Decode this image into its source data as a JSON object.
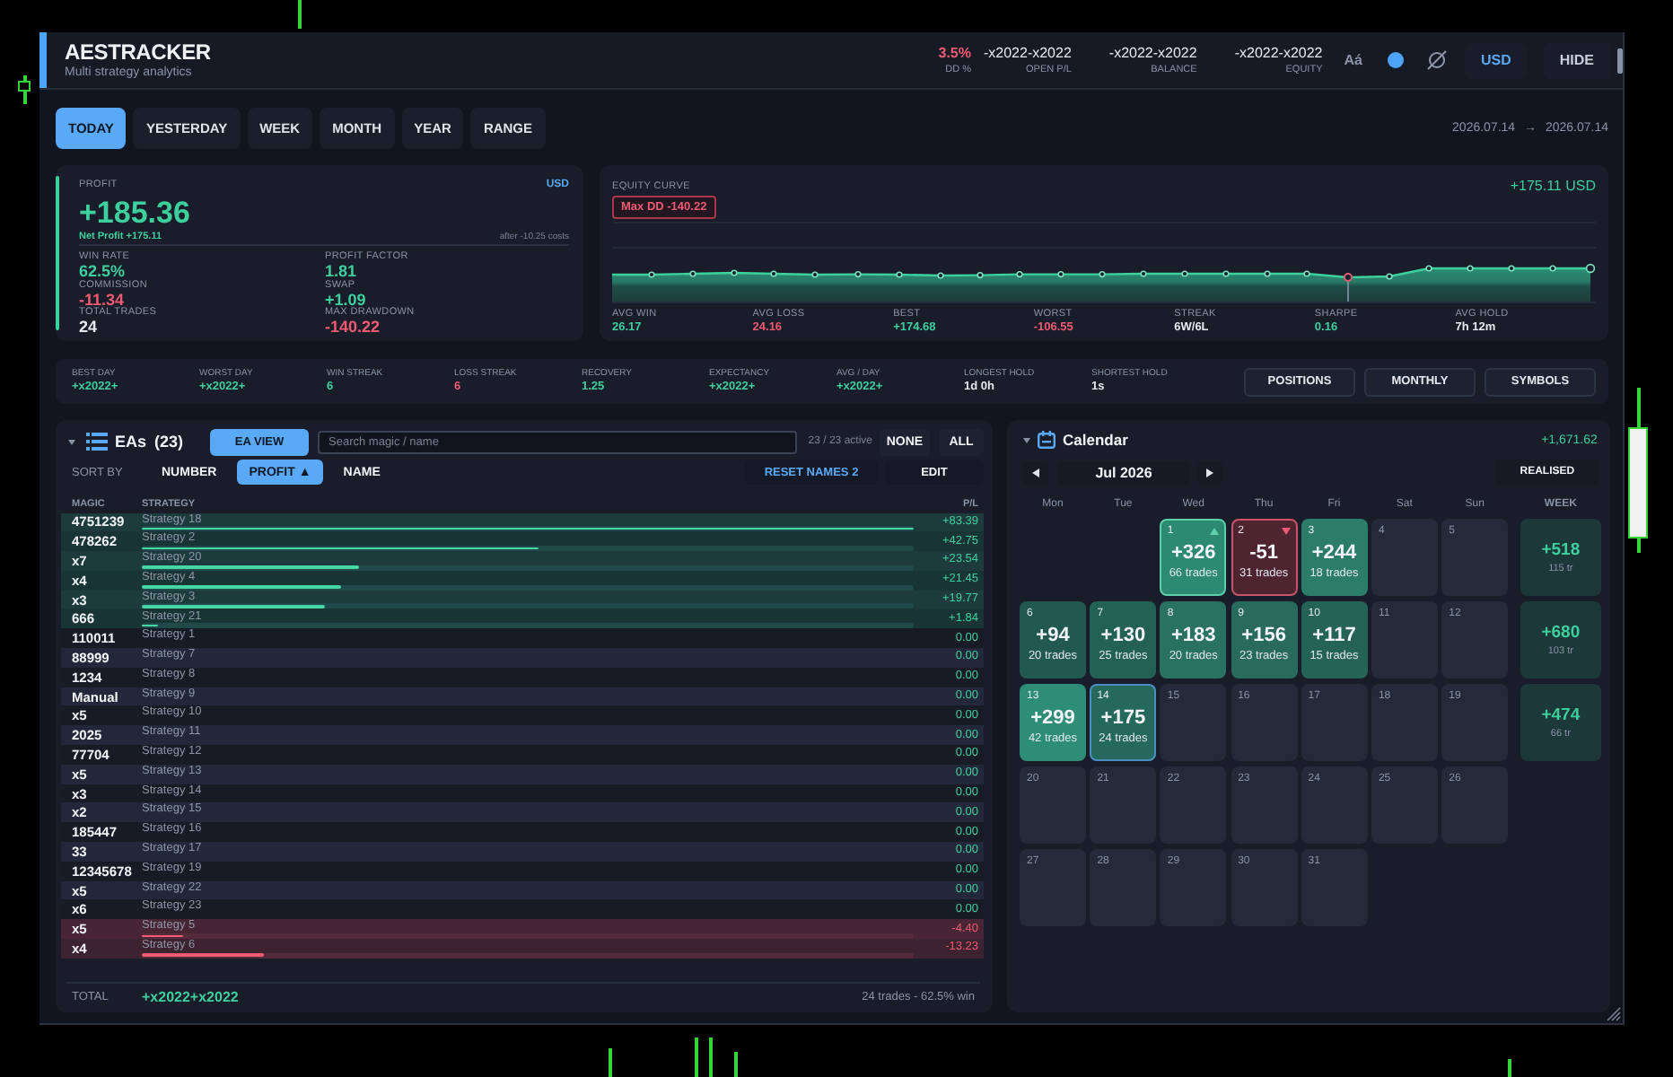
{
  "header": {
    "title": "AESTRACKER",
    "subtitle": "Multi strategy analytics",
    "stats": [
      {
        "value": "3.5%",
        "label": "DD %",
        "kind": "loss"
      },
      {
        "value": "-x2022-x2022",
        "label": "OPEN P/L",
        "kind": "neutral"
      },
      {
        "value": "-x2022-x2022",
        "label": "BALANCE",
        "kind": "neutral"
      },
      {
        "value": "-x2022-x2022",
        "label": "EQUITY",
        "kind": "neutral"
      }
    ],
    "font_button": "Aá",
    "currency_button": "USD",
    "hide_button": "HIDE"
  },
  "tabs": [
    {
      "label": "TODAY",
      "selected": true
    },
    {
      "label": "YESTERDAY",
      "selected": false
    },
    {
      "label": "WEEK",
      "selected": false
    },
    {
      "label": "MONTH",
      "selected": false
    },
    {
      "label": "YEAR",
      "selected": false
    },
    {
      "label": "RANGE",
      "selected": false
    }
  ],
  "date_range": "2026.07.14 → 2026.07.14",
  "profit": {
    "label": "PROFIT",
    "currency": "USD",
    "value": "+185.36",
    "net": "Net Profit +175.11",
    "costs": "after -10.25 costs",
    "stats": [
      {
        "label": "WIN RATE",
        "value": "62.5%",
        "kind": "gain"
      },
      {
        "label": "PROFIT FACTOR",
        "value": "1.81",
        "kind": "gain"
      },
      {
        "label": "COMMISSION",
        "value": "-11.34",
        "kind": "loss"
      },
      {
        "label": "SWAP",
        "value": "+1.09",
        "kind": "gain"
      },
      {
        "label": "TOTAL TRADES",
        "value": "24",
        "kind": "neutral"
      },
      {
        "label": "MAX DRAWDOWN",
        "value": "-140.22",
        "kind": "loss"
      }
    ]
  },
  "equity": {
    "label": "EQUITY CURVE",
    "total": "+175.11 USD",
    "max_dd": "Max DD -140.22",
    "stats": [
      {
        "label": "AVG WIN",
        "value": "26.17",
        "kind": "gain"
      },
      {
        "label": "AVG LOSS",
        "value": "24.16",
        "kind": "loss"
      },
      {
        "label": "BEST",
        "value": "+174.68",
        "kind": "gain"
      },
      {
        "label": "WORST",
        "value": "-106.55",
        "kind": "loss"
      },
      {
        "label": "STREAK",
        "value": "6W/6L",
        "kind": "neutral"
      },
      {
        "label": "SHARPE",
        "value": "0.16",
        "kind": "gain"
      },
      {
        "label": "AVG HOLD",
        "value": "7h 12m",
        "kind": "neutral"
      }
    ]
  },
  "summary": {
    "stats": [
      {
        "label": "BEST DAY",
        "value": "+x2022+",
        "kind": "gain"
      },
      {
        "label": "WORST DAY",
        "value": "+x2022+",
        "kind": "gain"
      },
      {
        "label": "WIN STREAK",
        "value": "6",
        "kind": "gain"
      },
      {
        "label": "LOSS STREAK",
        "value": "6",
        "kind": "loss"
      },
      {
        "label": "RECOVERY",
        "value": "1.25",
        "kind": "gain"
      },
      {
        "label": "EXPECTANCY",
        "value": "+x2022+",
        "kind": "gain"
      },
      {
        "label": "AVG / DAY",
        "value": "+x2022+",
        "kind": "gain"
      },
      {
        "label": "LONGEST HOLD",
        "value": "1d 0h",
        "kind": "neutral"
      },
      {
        "label": "SHORTEST HOLD",
        "value": "1s",
        "kind": "neutral"
      }
    ],
    "buttons": [
      "POSITIONS",
      "MONTHLY",
      "SYMBOLS"
    ]
  },
  "eas": {
    "title": "EAs (23)",
    "view_button": "EA VIEW",
    "search": {
      "placeholder": "Search magic / name"
    },
    "active": "23 / 23 active",
    "none_button": "NONE",
    "all_button": "ALL",
    "sort_label": "SORT BY",
    "sort_options": [
      {
        "label": "NUMBER",
        "selected": false
      },
      {
        "label": "PROFIT ▲",
        "selected": true
      },
      {
        "label": "NAME",
        "selected": false
      }
    ],
    "reset_button": "RESET NAMES 2",
    "edit_button": "EDIT",
    "columns": [
      "MAGIC",
      "STRATEGY",
      "P/L"
    ],
    "rows": [
      {
        "magic": "4751239",
        "strategy": "Strategy 18",
        "pl": "+83.39",
        "kind": "gain",
        "level": 1
      },
      {
        "magic": "478262",
        "strategy": "Strategy 2",
        "pl": "+42.75",
        "kind": "gain",
        "level": 0.513
      },
      {
        "magic": "x7",
        "strategy": "Strategy 20",
        "pl": "+23.54",
        "kind": "gain",
        "level": 0.282
      },
      {
        "magic": "x4",
        "strategy": "Strategy 4",
        "pl": "+21.45",
        "kind": "gain",
        "level": 0.257
      },
      {
        "magic": "x3",
        "strategy": "Strategy 3",
        "pl": "+19.77",
        "kind": "gain",
        "level": 0.237
      },
      {
        "magic": "666",
        "strategy": "Strategy 21",
        "pl": "+1.84",
        "kind": "gain",
        "level": 0.022
      },
      {
        "magic": "110011",
        "strategy": "Strategy 1",
        "pl": "0.00",
        "kind": "flat"
      },
      {
        "magic": "88999",
        "strategy": "Strategy 7",
        "pl": "0.00",
        "kind": "flat"
      },
      {
        "magic": "1234",
        "strategy": "Strategy 8",
        "pl": "0.00",
        "kind": "flat"
      },
      {
        "magic": "Manual",
        "strategy": "Strategy 9",
        "pl": "0.00",
        "kind": "flat"
      },
      {
        "magic": "x5",
        "strategy": "Strategy 10",
        "pl": "0.00",
        "kind": "flat"
      },
      {
        "magic": "2025",
        "strategy": "Strategy 11",
        "pl": "0.00",
        "kind": "flat"
      },
      {
        "magic": "77704",
        "strategy": "Strategy 12",
        "pl": "0.00",
        "kind": "flat"
      },
      {
        "magic": "x5",
        "strategy": "Strategy 13",
        "pl": "0.00",
        "kind": "flat"
      },
      {
        "magic": "x3",
        "strategy": "Strategy 14",
        "pl": "0.00",
        "kind": "flat"
      },
      {
        "magic": "x2",
        "strategy": "Strategy 15",
        "pl": "0.00",
        "kind": "flat"
      },
      {
        "magic": "185447",
        "strategy": "Strategy 16",
        "pl": "0.00",
        "kind": "flat"
      },
      {
        "magic": "33",
        "strategy": "Strategy 17",
        "pl": "0.00",
        "kind": "flat"
      },
      {
        "magic": "12345678",
        "strategy": "Strategy 19",
        "pl": "0.00",
        "kind": "flat"
      },
      {
        "magic": "x5",
        "strategy": "Strategy 22",
        "pl": "0.00",
        "kind": "flat"
      },
      {
        "magic": "x6",
        "strategy": "Strategy 23",
        "pl": "0.00",
        "kind": "flat"
      },
      {
        "magic": "x5",
        "strategy": "Strategy 5",
        "pl": "-4.40",
        "kind": "loss",
        "level": 0.053
      },
      {
        "magic": "x4",
        "strategy": "Strategy 6",
        "pl": "-13.23",
        "kind": "loss",
        "level": 0.159
      }
    ],
    "total": {
      "label": "TOTAL",
      "value": "+x2022+x2022",
      "summary": "24 trades - 62.5% win"
    }
  },
  "calendar": {
    "title": "Calendar",
    "total": "+1,671.62",
    "month": "Jul 2026",
    "mode_button": "REALISED",
    "weekdays": [
      "Mon",
      "Tue",
      "Wed",
      "Thu",
      "Fri",
      "Sat",
      "Sun",
      "WEEK"
    ],
    "weeks": [
      {
        "days": [
          {
            "kind": "blank"
          },
          {
            "kind": "blank"
          },
          {
            "kind": "best",
            "date": "1",
            "pl": "+326",
            "trades": "66 trades",
            "color": "#2c8a73",
            "today": false
          },
          {
            "kind": "worst",
            "date": "2",
            "pl": "-51",
            "trades": "31 trades",
            "color": "#4f2431",
            "today": false
          },
          {
            "kind": "day",
            "date": "3",
            "pl": "+244",
            "trades": "18 trades",
            "color": "#2b7d6a",
            "today": false
          },
          {
            "kind": "day",
            "date": "4",
            "today": false
          },
          {
            "kind": "day",
            "date": "5",
            "today": false
          }
        ],
        "total": {
          "pl": "+518",
          "trades": "115 tr"
        }
      },
      {
        "days": [
          {
            "kind": "day",
            "date": "6",
            "pl": "+94",
            "trades": "20 trades",
            "color": "#215950",
            "today": false
          },
          {
            "kind": "day",
            "date": "7",
            "pl": "+130",
            "trades": "25 trades",
            "color": "#246155",
            "today": false
          },
          {
            "kind": "day",
            "date": "8",
            "pl": "+183",
            "trades": "20 trades",
            "color": "#297262",
            "today": false
          },
          {
            "kind": "day",
            "date": "9",
            "pl": "+156",
            "trades": "23 trades",
            "color": "#286b5d",
            "today": false
          },
          {
            "kind": "day",
            "date": "10",
            "pl": "+117",
            "trades": "15 trades",
            "color": "#256357",
            "today": false
          },
          {
            "kind": "day",
            "date": "11",
            "today": false
          },
          {
            "kind": "day",
            "date": "12",
            "today": false
          }
        ],
        "total": {
          "pl": "+680",
          "trades": "103 tr"
        }
      },
      {
        "days": [
          {
            "kind": "day",
            "date": "13",
            "pl": "+299",
            "trades": "42 trades",
            "color": "#2e8d77",
            "today": false
          },
          {
            "kind": "day",
            "date": "14",
            "pl": "+175",
            "trades": "24 trades",
            "color": "#24695c",
            "today": true
          },
          {
            "kind": "day",
            "date": "15",
            "today": false
          },
          {
            "kind": "day",
            "date": "16",
            "today": false
          },
          {
            "kind": "day",
            "date": "17",
            "today": false
          },
          {
            "kind": "day",
            "date": "18",
            "today": false
          },
          {
            "kind": "day",
            "date": "19",
            "today": false
          }
        ],
        "total": {
          "pl": "+474",
          "trades": "66 tr"
        }
      },
      {
        "days": [
          {
            "kind": "day",
            "date": "20",
            "today": false
          },
          {
            "kind": "day",
            "date": "21",
            "today": false
          },
          {
            "kind": "day",
            "date": "22",
            "today": false
          },
          {
            "kind": "day",
            "date": "23",
            "today": false
          },
          {
            "kind": "day",
            "date": "24",
            "today": false
          },
          {
            "kind": "day",
            "date": "25",
            "today": false
          },
          {
            "kind": "day",
            "date": "26",
            "today": false
          }
        ]
      },
      {
        "days": [
          {
            "kind": "day",
            "date": "27",
            "today": false
          },
          {
            "kind": "day",
            "date": "28",
            "today": false
          },
          {
            "kind": "day",
            "date": "29",
            "today": false
          },
          {
            "kind": "day",
            "date": "30",
            "today": false
          },
          {
            "kind": "day",
            "date": "31",
            "today": false
          },
          {
            "kind": "blank"
          },
          {
            "kind": "blank"
          }
        ]
      }
    ]
  }
}
